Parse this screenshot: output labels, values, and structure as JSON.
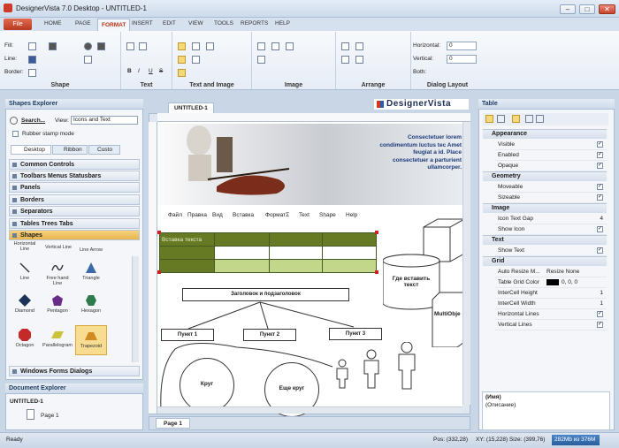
{
  "window": {
    "title": "DesignerVista 7.0  Desktop  -  UNTITLED-1",
    "min": "–",
    "max": "□",
    "close": "✕"
  },
  "ribbon": {
    "file_label": "File",
    "tabs": [
      "HOME",
      "PAGE",
      "FORMAT",
      "INSERT",
      "EDIT",
      "VIEW",
      "TOOLS",
      "REPORTS",
      "HELP"
    ],
    "active_tab": "FORMAT",
    "groups": [
      "Shape",
      "Text",
      "Text and Image",
      "Image",
      "Arrange",
      "Dialog Layout"
    ],
    "shape_labels": {
      "fill": "Fill:",
      "line": "Line:",
      "border": "Border:"
    },
    "dialog_layout": {
      "horizontal_label": "Horizontal:",
      "horizontal_value": "0",
      "vertical_label": "Vertical:",
      "vertical_value": "0",
      "both_label": "Both:"
    },
    "text_tools": {
      "bold": "B",
      "italic": "I",
      "underline": "U",
      "strike": "S"
    }
  },
  "shapes_explorer": {
    "title": "Shapes Explorer",
    "search_label": "Search...",
    "view_label": "View:",
    "view_value": "Icons and Text",
    "rubber_stamp": "Rubber stamp mode",
    "tabs": [
      "Desktop",
      "Ribbon",
      "Custo"
    ],
    "categories": [
      "Common Controls",
      "Toolbars Menus Statusbars",
      "Panels",
      "Borders",
      "Separators",
      "Tables Trees Tabs",
      "Shapes",
      "Windows Forms Dialogs"
    ],
    "shapes_row0": [
      "Horizontal Line",
      "Vertical Line",
      "Line Arrow"
    ],
    "shapes": [
      "Line",
      "Free hand Line",
      "Triangle",
      "Diamond",
      "Pentagon",
      "Hexagon",
      "Octagon",
      "Parallelogram",
      "Trapezoid"
    ]
  },
  "document_explorer": {
    "title": "Document Explorer",
    "doc_name": "UNTITLED-1",
    "page_label": "Page 1"
  },
  "document_tab": "UNTITLED-1",
  "page_tab": "Page 1",
  "canvas": {
    "logo": "DesignerVista",
    "lorem": "Consectetuer lorem condimentum luctus tec Amet feugiat a id. Place consectetuer a parturient ullamcorper.",
    "menu": [
      "Файл",
      "Правка",
      "Вид",
      "Вставка",
      "ФорматΣ",
      "Text",
      "Shape",
      "Help"
    ],
    "table_header": "Вставка текста",
    "flow_root": "Заголовок и подзаголовок",
    "flow_items": [
      "Пункт 1",
      "Пункт 2",
      "Пункт 3"
    ],
    "circles": [
      "Круг",
      "Еще круг"
    ],
    "cylinder": "Где вставить текст",
    "multi": "MultiObje"
  },
  "table_panel": {
    "title": "Table",
    "groups": {
      "appearance": "Appearance",
      "geometry": "Geometry",
      "image": "Image",
      "text": "Text",
      "grid": "Grid"
    },
    "appearance": [
      {
        "name": "Visible",
        "checked": true
      },
      {
        "name": "Enabled",
        "checked": true
      },
      {
        "name": "Opaque",
        "checked": true
      }
    ],
    "geometry": [
      {
        "name": "Moveable",
        "checked": true
      },
      {
        "name": "Sizeable",
        "checked": true
      }
    ],
    "image": [
      {
        "name": "Icon Text Gap",
        "value": "4"
      },
      {
        "name": "Show Icon",
        "checked": true
      }
    ],
    "text": [
      {
        "name": "Show Text",
        "checked": true
      }
    ],
    "grid": [
      {
        "name": "Auto Resize M...",
        "value": "Resize None"
      },
      {
        "name": "Table Grid Color",
        "value": "0, 0, 0"
      },
      {
        "name": "InterCell Height",
        "value": "1"
      },
      {
        "name": "InterCell Width",
        "value": "1"
      },
      {
        "name": "Horizontal Lines",
        "checked": true
      },
      {
        "name": "Vertical Lines",
        "checked": true
      }
    ],
    "desc_name": "(Имя)",
    "desc_text": "(Описание)"
  },
  "status": {
    "ready": "Ready",
    "pos": "Pos: (332,28)",
    "xy": "XY: (15,228) Size: (399,76)",
    "memory": "282Mb из 376M"
  },
  "colors": {
    "accent": "#b3300f",
    "table_olive": "#667a24",
    "table_light": "#c3d78a",
    "ribbon_bg": "#eef3f9"
  }
}
